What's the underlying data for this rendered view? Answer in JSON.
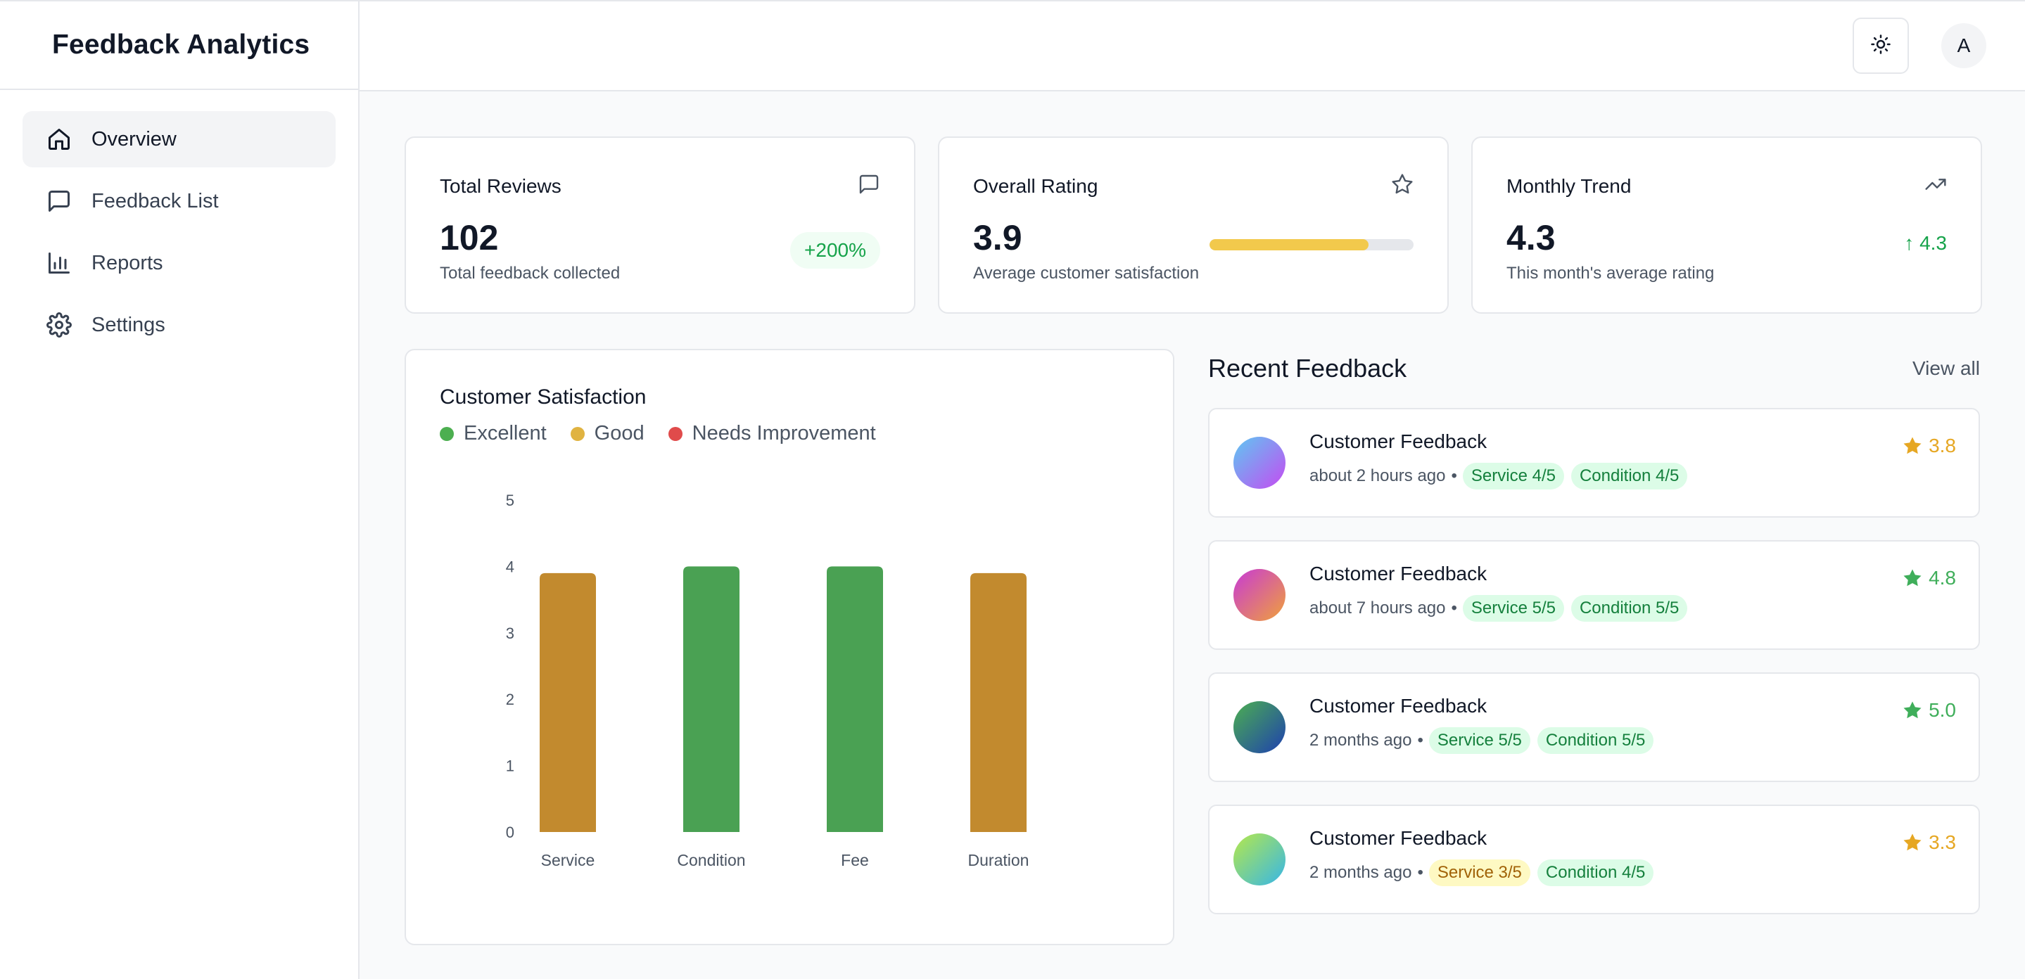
{
  "app": {
    "title": "Feedback Analytics"
  },
  "sidebar": {
    "items": [
      {
        "label": "Overview",
        "icon": "home-icon",
        "active": true
      },
      {
        "label": "Feedback List",
        "icon": "message-square-icon",
        "active": false
      },
      {
        "label": "Reports",
        "icon": "bar-chart-icon",
        "active": false
      },
      {
        "label": "Settings",
        "icon": "gear-icon",
        "active": false
      }
    ]
  },
  "topbar": {
    "theme_icon": "sun-icon",
    "avatar_initial": "A"
  },
  "stats": {
    "total_reviews": {
      "title": "Total Reviews",
      "value": "102",
      "sub": "Total feedback collected",
      "badge": "+200%",
      "icon": "message-square-icon"
    },
    "overall_rating": {
      "title": "Overall Rating",
      "value": "3.9",
      "sub": "Average customer satisfaction",
      "fill_fraction": 0.78,
      "icon": "star-icon"
    },
    "monthly_trend": {
      "title": "Monthly Trend",
      "value": "4.3",
      "sub": "This month's average rating",
      "trend": "↑ 4.3",
      "icon": "trending-up-icon"
    }
  },
  "chart": {
    "title": "Customer Satisfaction",
    "legend": [
      {
        "label": "Excellent",
        "color": "#4caf50"
      },
      {
        "label": "Good",
        "color": "#e0b341"
      },
      {
        "label": "Needs Improvement",
        "color": "#e04b4b"
      }
    ]
  },
  "chart_data": {
    "type": "bar",
    "title": "Customer Satisfaction",
    "categories": [
      "Service",
      "Condition",
      "Fee",
      "Duration"
    ],
    "values": [
      3.9,
      4.0,
      4.0,
      3.9
    ],
    "colors": [
      "#c28a2e",
      "#4aa153",
      "#4aa153",
      "#c28a2e"
    ],
    "ylim": [
      0,
      5
    ],
    "yticks": [
      "0",
      "1",
      "2",
      "3",
      "4",
      "5"
    ],
    "grid": false
  },
  "recent": {
    "title": "Recent Feedback",
    "view_all": "View all",
    "items": [
      {
        "title": "Customer Feedback",
        "time": "about 2 hours ago",
        "dot": "•",
        "tags": [
          {
            "text": "Service 4/5",
            "tone": "green"
          },
          {
            "text": "Condition 4/5",
            "tone": "green"
          }
        ],
        "score": "3.8",
        "score_color": "#e6a723",
        "avatar_from": "#5ec8f2",
        "avatar_to": "#c54bf2"
      },
      {
        "title": "Customer Feedback",
        "time": "about 7 hours ago",
        "dot": "•",
        "tags": [
          {
            "text": "Service 5/5",
            "tone": "green"
          },
          {
            "text": "Condition 5/5",
            "tone": "green"
          }
        ],
        "score": "4.8",
        "score_color": "#3fae5a",
        "avatar_from": "#c73ad6",
        "avatar_to": "#f0a13a"
      },
      {
        "title": "Customer Feedback",
        "time": "2 months ago",
        "dot": "•",
        "tags": [
          {
            "text": "Service 5/5",
            "tone": "green"
          },
          {
            "text": "Condition 5/5",
            "tone": "green"
          }
        ],
        "score": "5.0",
        "score_color": "#3fae5a",
        "avatar_from": "#4caf50",
        "avatar_to": "#1e40af"
      },
      {
        "title": "Customer Feedback",
        "time": "2 months ago",
        "dot": "•",
        "tags": [
          {
            "text": "Service 3/5",
            "tone": "yellow"
          },
          {
            "text": "Condition 4/5",
            "tone": "green"
          }
        ],
        "score": "3.3",
        "score_color": "#e6a723",
        "avatar_from": "#b6e84a",
        "avatar_to": "#36b6e8"
      }
    ]
  }
}
